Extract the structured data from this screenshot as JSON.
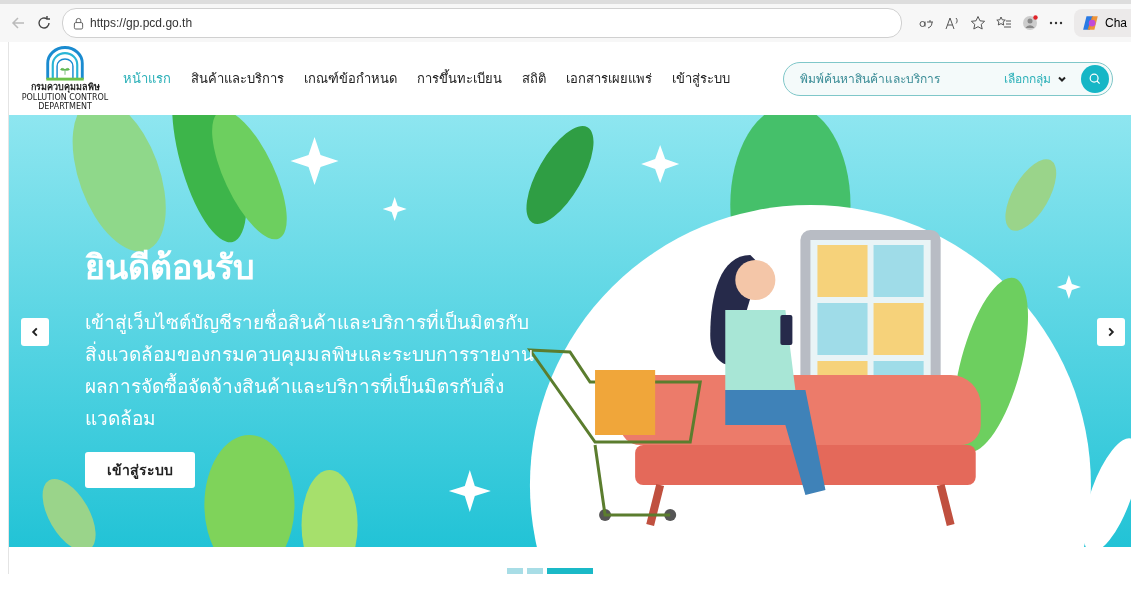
{
  "browser": {
    "url": "https://gp.pcd.go.th",
    "chat_label": "Cha"
  },
  "header": {
    "logo": {
      "name_th": "กรมควบคุมมลพิษ",
      "name_en": "POLLUTION CONTROL DEPARTMENT"
    },
    "nav": [
      {
        "label": "หน้าแรก",
        "selected": true
      },
      {
        "label": "สินค้าและบริการ",
        "selected": false
      },
      {
        "label": "เกณฑ์ข้อกำหนด",
        "selected": false
      },
      {
        "label": "การขึ้นทะเบียน",
        "selected": false
      },
      {
        "label": "สถิติ",
        "selected": false
      },
      {
        "label": "เอกสารเผยแพร่",
        "selected": false
      },
      {
        "label": "เข้าสู่ระบบ",
        "selected": false
      }
    ],
    "search": {
      "placeholder": "พิมพ์ค้นหาสินค้าและบริการ",
      "category": "เลือกกลุ่ม"
    }
  },
  "hero": {
    "title": "ยินดีต้อนรับ",
    "text": "เข้าสู่เว็บไซต์บัญชีรายชื่อสินค้าและบริการที่เป็นมิตรกับสิ่งแวดล้อมของกรมควบคุมมลพิษและระบบการรายงานผลการจัดซื้อจัดจ้างสินค้าและบริการที่เป็นมิตรกับสิ่งแวดล้อม",
    "button": "เข้าสู่ระบบ"
  },
  "carousel": [
    {
      "selected": false
    },
    {
      "selected": false
    },
    {
      "selected": true
    }
  ]
}
